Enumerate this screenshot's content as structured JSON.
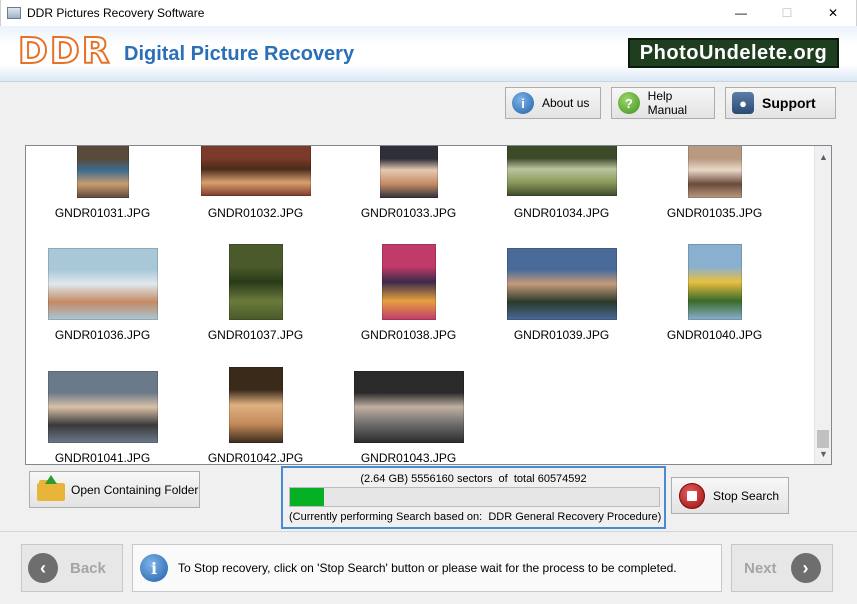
{
  "window": {
    "title": "DDR Pictures Recovery Software",
    "minimize": "—",
    "maximize": "☐",
    "close": "✕"
  },
  "header": {
    "logo": "DDR",
    "heading": "Digital Picture Recovery",
    "brand": "PhotoUndelete.org"
  },
  "toolbar": {
    "about": "About us",
    "help": "Help Manual",
    "support": "Support"
  },
  "gallery": {
    "files": [
      {
        "name": "GNDR01031.JPG",
        "colors": [
          "#5a4a3a",
          "#c99b6e",
          "#3b6b8f"
        ]
      },
      {
        "name": "GNDR01032.JPG",
        "colors": [
          "#7a3b2a",
          "#d9a070",
          "#4a2a1a"
        ]
      },
      {
        "name": "GNDR01033.JPG",
        "colors": [
          "#2f2f3a",
          "#c48a64",
          "#e6c9b0"
        ]
      },
      {
        "name": "GNDR01034.JPG",
        "colors": [
          "#3d4a2a",
          "#8a9a5a",
          "#bcc4a0"
        ]
      },
      {
        "name": "GNDR01035.JPG",
        "colors": [
          "#b89a80",
          "#6a4a3a",
          "#e9d8c8"
        ]
      },
      {
        "name": "GNDR01036.JPG",
        "colors": [
          "#a8c8d8",
          "#c48a64",
          "#e0e8ec"
        ]
      },
      {
        "name": "GNDR01037.JPG",
        "colors": [
          "#4a5a2a",
          "#6b7a3a",
          "#2a3a1a"
        ]
      },
      {
        "name": "GNDR01038.JPG",
        "colors": [
          "#c03a6a",
          "#e6a040",
          "#3a2a4a"
        ]
      },
      {
        "name": "GNDR01039.JPG",
        "colors": [
          "#4a6a9a",
          "#2a3a2a",
          "#c49a7a"
        ]
      },
      {
        "name": "GNDR01040.JPG",
        "colors": [
          "#8ab0d0",
          "#3a6a2a",
          "#e8c040"
        ]
      },
      {
        "name": "GNDR01041.JPG",
        "colors": [
          "#6a7a8a",
          "#3a3a3a",
          "#d8c0a8"
        ]
      },
      {
        "name": "GNDR01042.JPG",
        "colors": [
          "#3a2a1a",
          "#c48a5a",
          "#e0b080"
        ]
      },
      {
        "name": "GNDR01043.JPG",
        "colors": [
          "#2a2a2a",
          "#6a6a6a",
          "#c0b0a0"
        ]
      }
    ]
  },
  "actions": {
    "open_folder": "Open Containing Folder",
    "stop": "Stop Search"
  },
  "progress": {
    "size": "(2.64 GB)",
    "sectors_done": "5556160",
    "sectors_label": "sectors  of  total",
    "sectors_total": "60574592",
    "fraction": 0.092,
    "status": "(Currently performing Search based on:  DDR General Recovery Procedure)"
  },
  "nav": {
    "back": "Back",
    "next": "Next",
    "hint": "To Stop recovery, click on 'Stop Search' button or please wait for the process to be completed."
  }
}
